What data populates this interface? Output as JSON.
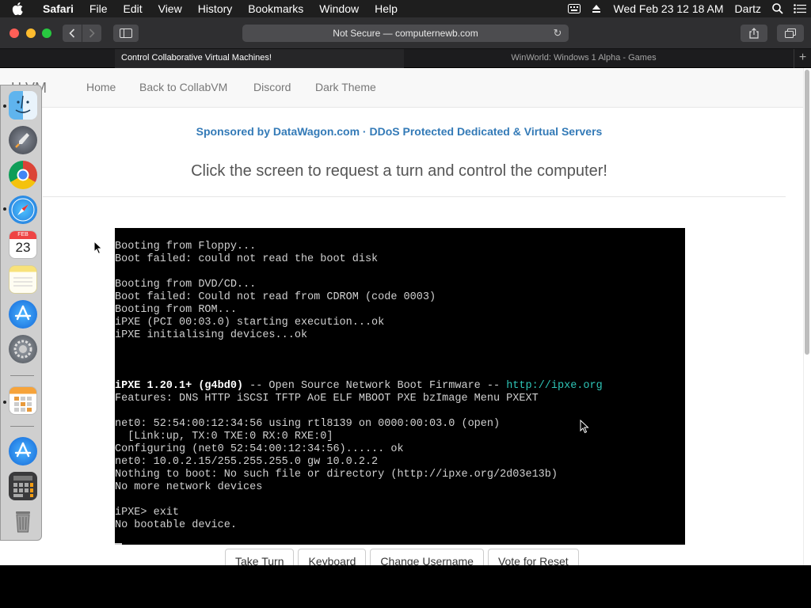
{
  "menubar": {
    "app_name": "Safari",
    "items": [
      "File",
      "Edit",
      "View",
      "History",
      "Bookmarks",
      "Window",
      "Help"
    ],
    "clock": "Wed Feb 23  12 18 AM",
    "user": "Dartz"
  },
  "toolbar": {
    "url": "Not Secure — computernewb.com"
  },
  "tabs": [
    {
      "title": "Control Collaborative Virtual Machines!",
      "active": true
    },
    {
      "title": "WinWorld: Windows 1 Alpha - Games",
      "active": false
    }
  ],
  "navbar": {
    "brand": "U  VM",
    "links": [
      "Home",
      "Back to CollabVM",
      "Discord",
      "Dark Theme"
    ]
  },
  "sponsor": "Sponsored by DataWagon.com · DDoS Protected Dedicated & Virtual Servers",
  "headline": "Click the screen to request a turn and control the computer!",
  "console": {
    "lines": [
      "Booting from Floppy...",
      "Boot failed: could not read the boot disk",
      "",
      "Booting from DVD/CD...",
      "Boot failed: Could not read from CDROM (code 0003)",
      "Booting from ROM...",
      "iPXE (PCI 00:03.0) starting execution...ok",
      "iPXE initialising devices...ok",
      "",
      "",
      "",
      "iPXE 1.20.1+ (g4bd0) -- Open Source Network Boot Firmware -- http://ipxe.org",
      "Features: DNS HTTP iSCSI TFTP AoE ELF MBOOT PXE bzImage Menu PXEXT",
      "",
      "net0: 52:54:00:12:34:56 using rtl8139 on 0000:00:03.0 (open)",
      "  [Link:up, TX:0 TXE:0 RX:0 RXE:0]",
      "Configuring (net0 52:54:00:12:34:56)...... ok",
      "net0: 10.0.2.15/255.255.255.0 gw 10.0.2.2",
      "Nothing to boot: No such file or directory (http://ipxe.org/2d03e13b)",
      "No more network devices",
      "",
      "iPXE> exit",
      "No bootable device."
    ],
    "banner_bright": "iPXE 1.20.1+ (g4bd0)",
    "banner_mid": " -- Open Source Network Boot Firmware -- ",
    "banner_link": "http://ipxe.org"
  },
  "vm_buttons": [
    "Take Turn",
    "Keyboard",
    "Change Username",
    "Vote for Reset"
  ],
  "dock": {
    "apps": [
      "finder-icon",
      "launchpad-icon",
      "chrome-icon",
      "safari-icon",
      "calendar-icon",
      "notes-icon",
      "app-store-icon",
      "system-preferences-icon",
      "numbers-icon",
      "app-store-installer-icon",
      "calculator-icon",
      "trash-icon"
    ],
    "calendar_month": "FEB",
    "calendar_day": "23"
  },
  "colors": {
    "link": "#337ab7",
    "console_link": "#2ec4b6"
  }
}
